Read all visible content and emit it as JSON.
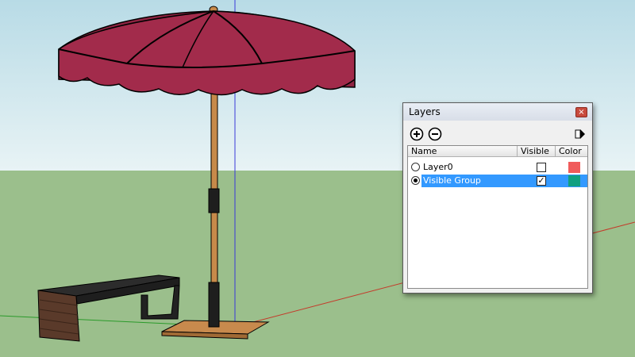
{
  "scene": {
    "sky_color": "#cfe6ee",
    "ground_color": "#9bbf8c",
    "canopy_color": "#a02a48",
    "pole_color": "#c78a4a",
    "bench_color": "#2a2a2a",
    "base_color": "#c88a4d"
  },
  "layers_dialog": {
    "title": "Layers",
    "close_icon": "close-icon",
    "add_icon": "add-layer-icon",
    "remove_icon": "remove-layer-icon",
    "details_icon": "details-arrow-icon",
    "columns": {
      "name": "Name",
      "visible": "Visible",
      "color": "Color"
    },
    "rows": [
      {
        "name": "Layer0",
        "active": false,
        "visible": false,
        "color": "#f05b5b",
        "selected": false
      },
      {
        "name": "Visible Group",
        "active": true,
        "visible": true,
        "color": "#10a080",
        "selected": true
      }
    ]
  }
}
